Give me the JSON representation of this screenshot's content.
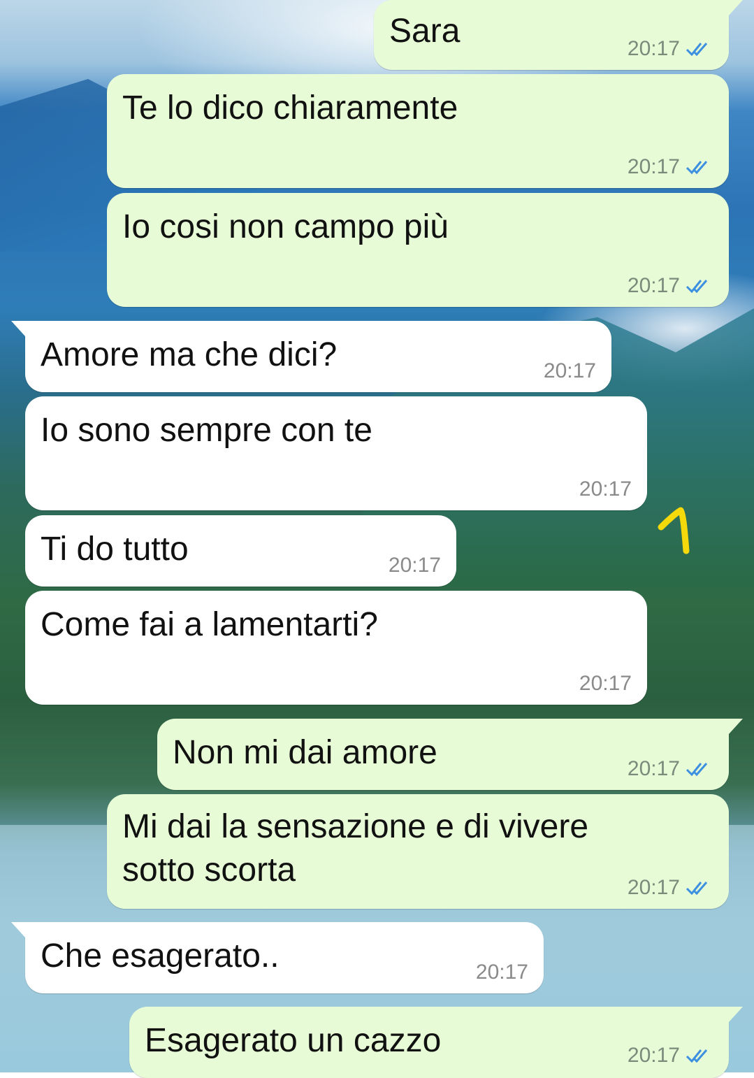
{
  "colors": {
    "outgoing_bubble": "#e7fcd6",
    "incoming_bubble": "#ffffff",
    "read_ticks": "#3d8fe0",
    "annotation": "#f5d90a"
  },
  "messages": [
    {
      "direction": "out",
      "text": "Sara",
      "time": "20:17",
      "status": "read-double-check-icon"
    },
    {
      "direction": "out",
      "text": "Te lo dico chiaramente",
      "time": "20:17",
      "status": "read-double-check-icon"
    },
    {
      "direction": "out",
      "text": "Io cosi non campo più",
      "time": "20:17",
      "status": "read-double-check-icon"
    },
    {
      "direction": "in",
      "text": "Amore ma che dici?",
      "time": "20:17"
    },
    {
      "direction": "in",
      "text": "Io sono sempre con te",
      "time": "20:17"
    },
    {
      "direction": "in",
      "text": "Ti do tutto",
      "time": "20:17"
    },
    {
      "direction": "in",
      "text": "Come fai a lamentarti?",
      "time": "20:17"
    },
    {
      "direction": "out",
      "text": "Non mi dai amore",
      "time": "20:17",
      "status": "read-double-check-icon"
    },
    {
      "direction": "out",
      "text": "Mi dai la sensazione e di vivere\nsotto scorta",
      "time": "20:17",
      "status": "read-double-check-icon"
    },
    {
      "direction": "in",
      "text": "Che esagerato..",
      "time": "20:17"
    },
    {
      "direction": "out",
      "text": "Esagerato un cazzo",
      "time": "20:17",
      "status": "read-double-check-icon"
    }
  ],
  "annotation": {
    "text": "1"
  }
}
